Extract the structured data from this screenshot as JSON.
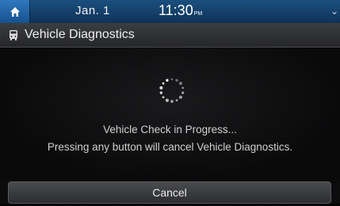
{
  "status_bar": {
    "date": "Jan.  1",
    "time": "11:30",
    "ampm": "PM",
    "icons": [
      "home-icon",
      "chevron-down-icon"
    ]
  },
  "header": {
    "icon": "vehicle-icon",
    "title": "Vehicle Diagnostics"
  },
  "main": {
    "spinner_icon": "loading-spinner-icon",
    "message_line1": "Vehicle Check in Progress...",
    "message_line2": "Pressing any button will cancel Vehicle Diagnostics."
  },
  "footer": {
    "cancel_label": "Cancel"
  },
  "colors": {
    "status_bar": "#17466f",
    "home_button": "#2f78bd",
    "background": "#0c0c0d",
    "text": "#e6e6e6"
  }
}
